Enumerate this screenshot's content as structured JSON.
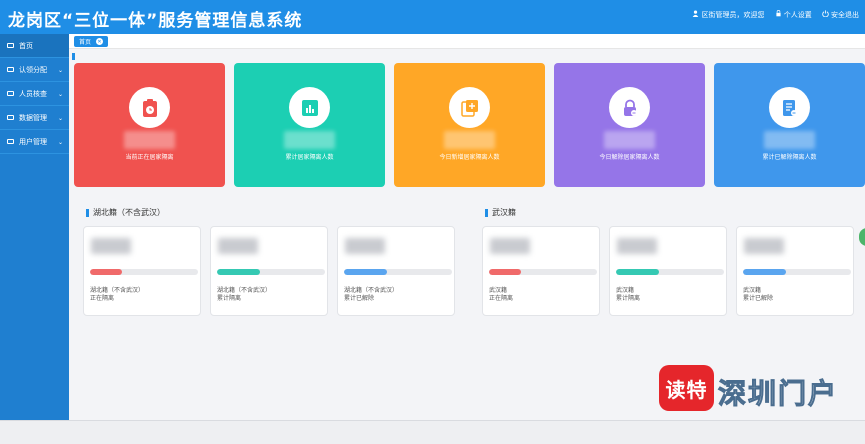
{
  "header": {
    "title": "龙岗区“三位一体”服务管理信息系统",
    "user_text": "区街管理员，欢迎您",
    "settings_label": "个人设置",
    "logout_label": "安全退出"
  },
  "sidebar": {
    "items": [
      {
        "label": "首页"
      },
      {
        "label": "认领分配"
      },
      {
        "label": "人员核查"
      },
      {
        "label": "数据管理"
      },
      {
        "label": "用户管理"
      }
    ]
  },
  "tabs": [
    {
      "label": "首页"
    }
  ],
  "stats": [
    {
      "label": "当前正在居家隔离",
      "color": "#f0524f",
      "icon": "timer-clipboard-icon"
    },
    {
      "label": "累计居家隔离人数",
      "color": "#1ccfb3",
      "icon": "bar-chart-icon"
    },
    {
      "label": "今日新增居家隔离人数",
      "color": "#ffa726",
      "icon": "add-document-icon"
    },
    {
      "label": "今日解除居家隔离人数",
      "color": "#9575e8",
      "icon": "lock-icon"
    },
    {
      "label": "累计已解除隔离人数",
      "color": "#3f97ec",
      "icon": "document-icon"
    }
  ],
  "sections": [
    {
      "title": "湖北籍（不含武汉）",
      "cards": [
        {
          "line1": "湖北籍（不含武汉）",
          "line2": "正在隔离",
          "color": "#f06a6a",
          "progress": 0.3
        },
        {
          "line1": "湖北籍（不含武汉）",
          "line2": "累计隔离",
          "color": "#35c9b3",
          "progress": 0.4
        },
        {
          "line1": "湖北籍（不含武汉）",
          "line2": "累计已解除",
          "color": "#5aa5ef",
          "progress": 0.4
        }
      ]
    },
    {
      "title": "武汉籍",
      "cards": [
        {
          "line1": "武汉籍",
          "line2": "正在隔离",
          "color": "#f06a6a",
          "progress": 0.3
        },
        {
          "line1": "武汉籍",
          "line2": "累计隔离",
          "color": "#35c9b3",
          "progress": 0.4
        },
        {
          "line1": "武汉籍",
          "line2": "累计已解除",
          "color": "#5aa5ef",
          "progress": 0.4
        }
      ]
    }
  ],
  "watermark": {
    "badge": "读特",
    "text": "深圳门户"
  }
}
